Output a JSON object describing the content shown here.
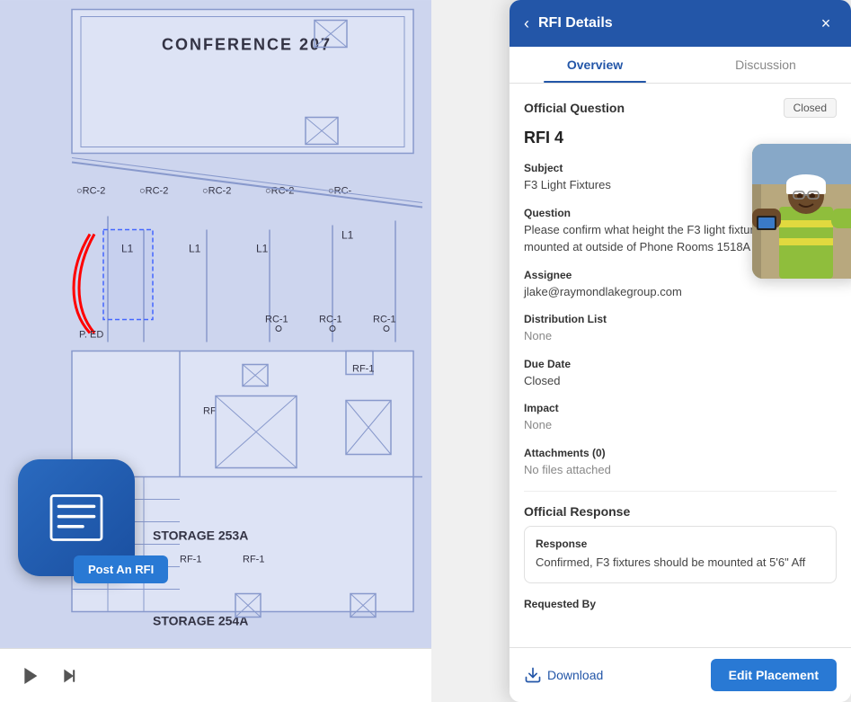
{
  "header": {
    "title": "RFI Details",
    "close_label": "×",
    "back_label": "‹"
  },
  "tabs": [
    {
      "id": "overview",
      "label": "Overview",
      "active": true
    },
    {
      "id": "discussion",
      "label": "Discussion",
      "active": false
    }
  ],
  "rfi": {
    "number": "RFI 4",
    "status": "Closed",
    "official_question_label": "Official Question",
    "subject_label": "Subject",
    "subject_value": "F3 Light Fixtures",
    "question_label": "Question",
    "question_value": "Please confirm what height the F3 light fixtures should be mounted at outside of Phone Rooms 1518A and 1518B.",
    "assignee_label": "Assignee",
    "assignee_value": "jlake@raymondlakegroup.com",
    "distribution_label": "Distribution List",
    "distribution_value": "None",
    "due_date_label": "Due Date",
    "due_date_value": "Closed",
    "impact_label": "Impact",
    "impact_value": "None",
    "attachments_label": "Attachments (0)",
    "attachments_value": "No files attached",
    "official_response_label": "Official Response",
    "response_label": "Response",
    "response_value": "Confirmed, F3 fixtures should be mounted at 5'6\" Aff",
    "requested_by_label": "Requested By"
  },
  "footer": {
    "download_label": "Download",
    "edit_placement_label": "Edit Placement"
  },
  "toolbar": {
    "play_icon": "▶",
    "skip_icon": "⏭"
  },
  "post_rfi_button": "Post An RFI",
  "colors": {
    "primary_blue": "#2356a8",
    "button_blue": "#2979d4",
    "status_bg": "#f5f5f5"
  }
}
